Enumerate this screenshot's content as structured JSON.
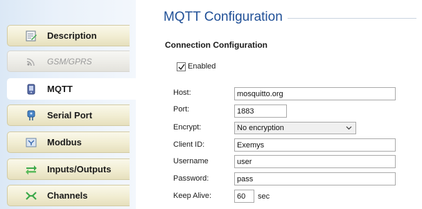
{
  "sidebar": {
    "items": [
      {
        "label": "Description",
        "icon": "description-icon",
        "state": "normal"
      },
      {
        "label": "GSM/GPRS",
        "icon": "signal-icon",
        "state": "disabled"
      },
      {
        "label": "MQTT",
        "icon": "mqtt-icon",
        "state": "active"
      },
      {
        "label": "Serial Port",
        "icon": "serial-port-icon",
        "state": "normal"
      },
      {
        "label": "Modbus",
        "icon": "modbus-icon",
        "state": "normal"
      },
      {
        "label": "Inputs/Outputs",
        "icon": "inputs-outputs-icon",
        "state": "normal"
      },
      {
        "label": "Channels",
        "icon": "channels-icon",
        "state": "normal"
      }
    ]
  },
  "main": {
    "title": "MQTT Configuration",
    "section_title": "Connection Configuration",
    "enabled": {
      "label": "Enabled",
      "checked": true
    },
    "fields": {
      "host": {
        "label": "Host:",
        "value": "mosquitto.org"
      },
      "port": {
        "label": "Port:",
        "value": "1883"
      },
      "encrypt": {
        "label": "Encrypt:",
        "value": "No encryption"
      },
      "client_id": {
        "label": "Client ID:",
        "value": "Exemys"
      },
      "username": {
        "label": "Username",
        "value": "user"
      },
      "password": {
        "label": "Password:",
        "value": "pass"
      },
      "keep_alive": {
        "label": "Keep Alive:",
        "value": "60",
        "unit": "sec"
      }
    }
  },
  "colors": {
    "title": "#1f4f96",
    "sidebar_bg": "#dbe8f6",
    "tab_bg": "#f1edd2"
  }
}
